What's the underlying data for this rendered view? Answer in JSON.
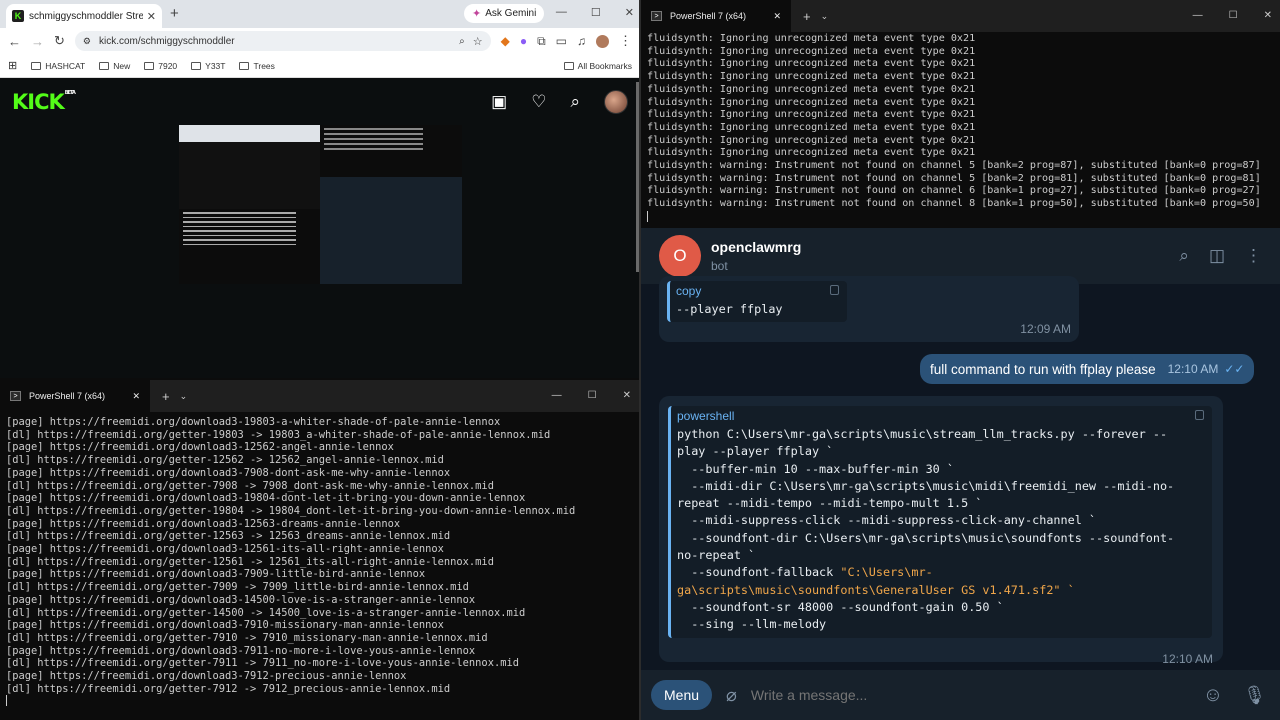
{
  "browser": {
    "tab_title": "schmiggyschmoddler Stream -",
    "tab_favicon": "K",
    "gemini_label": "Ask Gemini",
    "url": "kick.com/schmiggyschmoddler",
    "bookmarks": [
      "HASHCAT",
      "New",
      "7920",
      "Y33T",
      "Trees"
    ],
    "all_bookmarks": "All Bookmarks",
    "site_logo": "KICK",
    "site_logo_badge": "BETA",
    "accent": "#53fc18"
  },
  "term_top": {
    "tab_title": "PowerShell 7 (x64)",
    "lines": [
      "fluidsynth: Ignoring unrecognized meta event type 0x21",
      "fluidsynth: Ignoring unrecognized meta event type 0x21",
      "fluidsynth: Ignoring unrecognized meta event type 0x21",
      "fluidsynth: Ignoring unrecognized meta event type 0x21",
      "fluidsynth: Ignoring unrecognized meta event type 0x21",
      "fluidsynth: Ignoring unrecognized meta event type 0x21",
      "fluidsynth: Ignoring unrecognized meta event type 0x21",
      "fluidsynth: Ignoring unrecognized meta event type 0x21",
      "fluidsynth: Ignoring unrecognized meta event type 0x21",
      "fluidsynth: Ignoring unrecognized meta event type 0x21",
      "fluidsynth: warning: Instrument not found on channel 5 [bank=2 prog=87], substituted [bank=0 prog=87]",
      "fluidsynth: warning: Instrument not found on channel 5 [bank=2 prog=81], substituted [bank=0 prog=81]",
      "fluidsynth: warning: Instrument not found on channel 6 [bank=1 prog=27], substituted [bank=0 prog=27]",
      "fluidsynth: warning: Instrument not found on channel 8 [bank=1 prog=50], substituted [bank=0 prog=50]"
    ]
  },
  "term_bottom": {
    "tab_title": "PowerShell 7 (x64)",
    "lines": [
      "[page] https://freemidi.org/download3-19803-a-whiter-shade-of-pale-annie-lennox",
      "[dl] https://freemidi.org/getter-19803 -> 19803_a-whiter-shade-of-pale-annie-lennox.mid",
      "[page] https://freemidi.org/download3-12562-angel-annie-lennox",
      "[dl] https://freemidi.org/getter-12562 -> 12562_angel-annie-lennox.mid",
      "[page] https://freemidi.org/download3-7908-dont-ask-me-why-annie-lennox",
      "[dl] https://freemidi.org/getter-7908 -> 7908_dont-ask-me-why-annie-lennox.mid",
      "[page] https://freemidi.org/download3-19804-dont-let-it-bring-you-down-annie-lennox",
      "[dl] https://freemidi.org/getter-19804 -> 19804_dont-let-it-bring-you-down-annie-lennox.mid",
      "[page] https://freemidi.org/download3-12563-dreams-annie-lennox",
      "[dl] https://freemidi.org/getter-12563 -> 12563_dreams-annie-lennox.mid",
      "[page] https://freemidi.org/download3-12561-its-all-right-annie-lennox",
      "[dl] https://freemidi.org/getter-12561 -> 12561_its-all-right-annie-lennox.mid",
      "[page] https://freemidi.org/download3-7909-little-bird-annie-lennox",
      "[dl] https://freemidi.org/getter-7909 -> 7909_little-bird-annie-lennox.mid",
      "[page] https://freemidi.org/download3-14500-love-is-a-stranger-annie-lennox",
      "[dl] https://freemidi.org/getter-14500 -> 14500_love-is-a-stranger-annie-lennox.mid",
      "[page] https://freemidi.org/download3-7910-missionary-man-annie-lennox",
      "[dl] https://freemidi.org/getter-7910 -> 7910_missionary-man-annie-lennox.mid",
      "[page] https://freemidi.org/download3-7911-no-more-i-love-yous-annie-lennox",
      "[dl] https://freemidi.org/getter-7911 -> 7911_no-more-i-love-yous-annie-lennox.mid",
      "[page] https://freemidi.org/download3-7912-precious-annie-lennox",
      "[dl] https://freemidi.org/getter-7912 -> 7912_precious-annie-lennox.mid"
    ]
  },
  "telegram": {
    "contact_initial": "O",
    "contact_name": "openclawmrg",
    "contact_status": "bot",
    "msg1": {
      "code_lang": "copy",
      "code": "--player ffplay",
      "time": "12:09 AM"
    },
    "msg2": {
      "text": "full command to run with ffplay please",
      "time": "12:10 AM",
      "ticks": "✓✓"
    },
    "msg3": {
      "code_lang": "powershell",
      "code_lines": [
        "python C:\\Users\\mr-ga\\scripts\\music\\stream_llm_tracks.py --forever --",
        "play --player ffplay `",
        "  --buffer-min 10 --max-buffer-min 30 `",
        "  --midi-dir C:\\Users\\mr-ga\\scripts\\music\\midi\\freemidi_new --midi-no-",
        "repeat --midi-tempo --midi-tempo-mult 1.5 `",
        "  --midi-suppress-click --midi-suppress-click-any-channel `",
        "  --soundfont-dir C:\\Users\\mr-ga\\scripts\\music\\soundfonts --soundfont-",
        "no-repeat `",
        "  --soundfont-fallback ",
        "ga\\scripts\\music\\soundfonts\\GeneralUser GS v1.471.sf2\" `",
        "  --soundfont-sr 48000 --soundfont-gain 0.50 `",
        "  --sing --llm-melody"
      ],
      "string_part": "\"C:\\Users\\mr-",
      "time": "12:10 AM"
    },
    "menu_label": "Menu",
    "input_placeholder": "Write a message...",
    "accent": "#6ab3f3"
  }
}
